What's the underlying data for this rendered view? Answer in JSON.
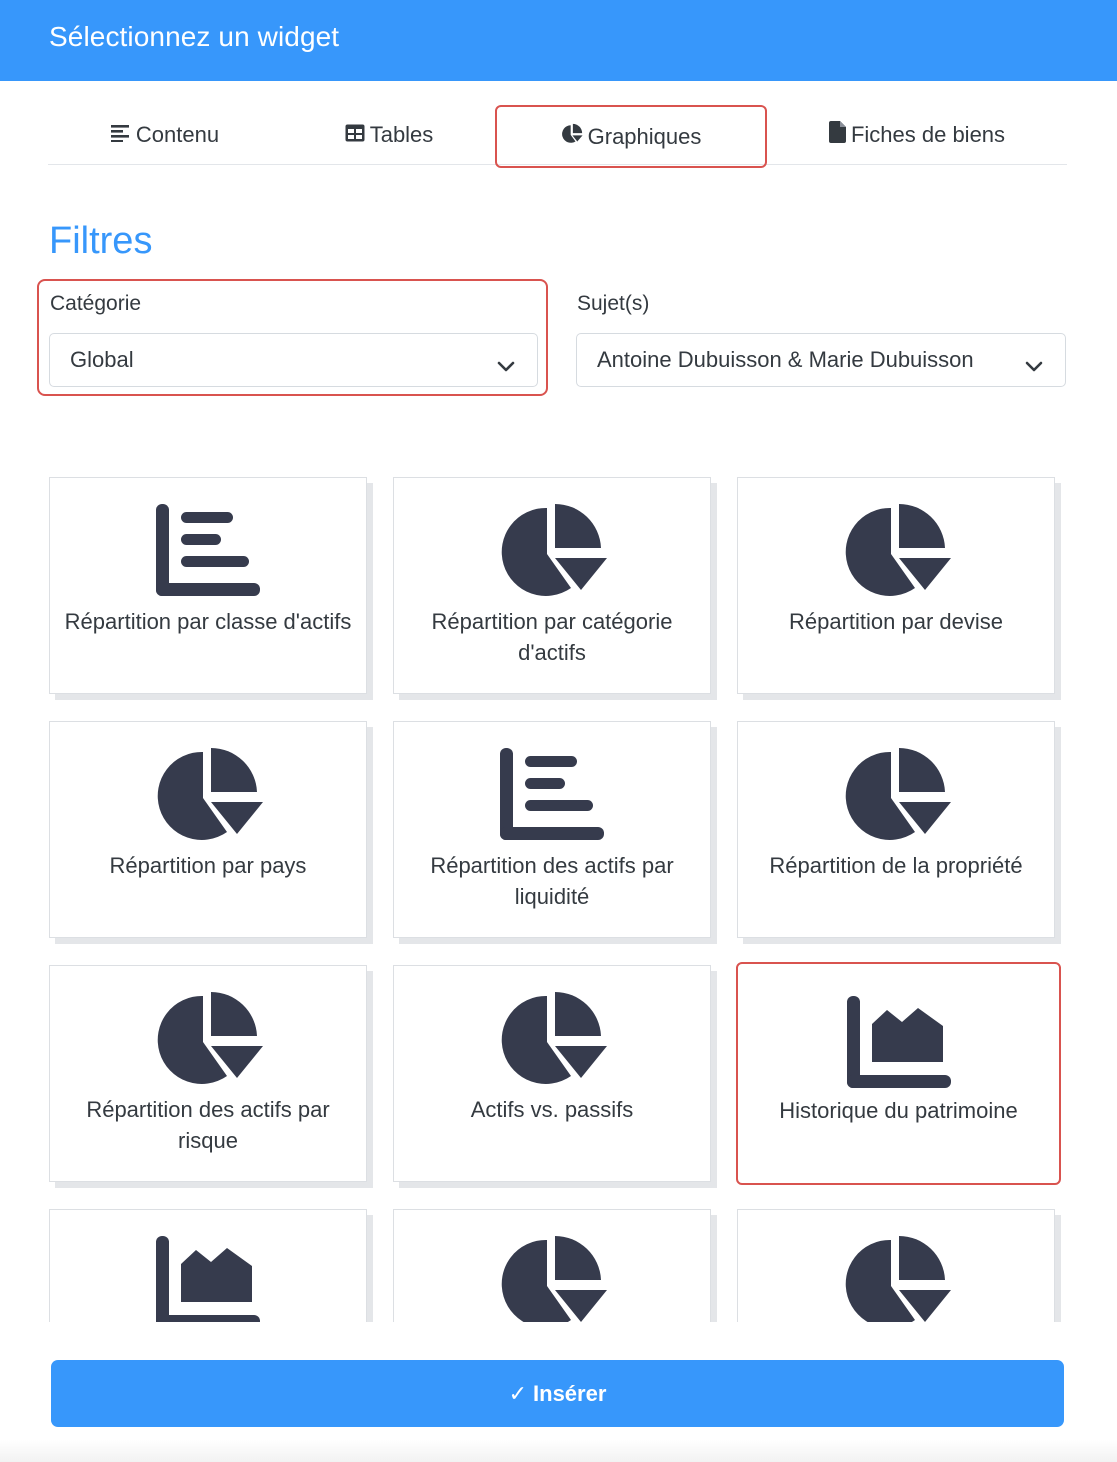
{
  "header": {
    "title": "Sélectionnez un widget"
  },
  "tabs": [
    {
      "label": "Contenu",
      "icon": "align-left-icon"
    },
    {
      "label": "Tables",
      "icon": "table-icon"
    },
    {
      "label": "Graphiques",
      "icon": "pie-chart-icon",
      "active": true
    },
    {
      "label": "Fiches de biens",
      "icon": "file-icon"
    }
  ],
  "filters": {
    "title": "Filtres",
    "category": {
      "label": "Catégorie",
      "value": "Global"
    },
    "subjects": {
      "label": "Sujet(s)",
      "value": "Antoine Dubuisson & Marie Dubuisson"
    }
  },
  "widgets": [
    {
      "label": "Répartition par classe d'actifs",
      "icon": "bar-chart-icon"
    },
    {
      "label": "Répartition par catégorie d'actifs",
      "icon": "pie-chart-icon"
    },
    {
      "label": "Répartition par devise",
      "icon": "pie-chart-icon"
    },
    {
      "label": "Répartition par pays",
      "icon": "pie-chart-icon"
    },
    {
      "label": "Répartition des actifs par liquidité",
      "icon": "bar-chart-icon"
    },
    {
      "label": "Répartition de la propriété",
      "icon": "pie-chart-icon"
    },
    {
      "label": "Répartition des actifs par risque",
      "icon": "pie-chart-icon"
    },
    {
      "label": "Actifs vs. passifs",
      "icon": "pie-chart-icon"
    },
    {
      "label": "Historique du patrimoine",
      "icon": "area-chart-icon",
      "selected": true
    },
    {
      "label": "",
      "icon": "area-chart-icon"
    },
    {
      "label": "",
      "icon": "pie-chart-icon"
    },
    {
      "label": "",
      "icon": "pie-chart-icon"
    }
  ],
  "footer": {
    "insert_label": "Insérer",
    "check_glyph": "✓"
  },
  "colors": {
    "primary": "#3797fb",
    "highlight": "#d9534f",
    "icon": "#363b4d"
  }
}
